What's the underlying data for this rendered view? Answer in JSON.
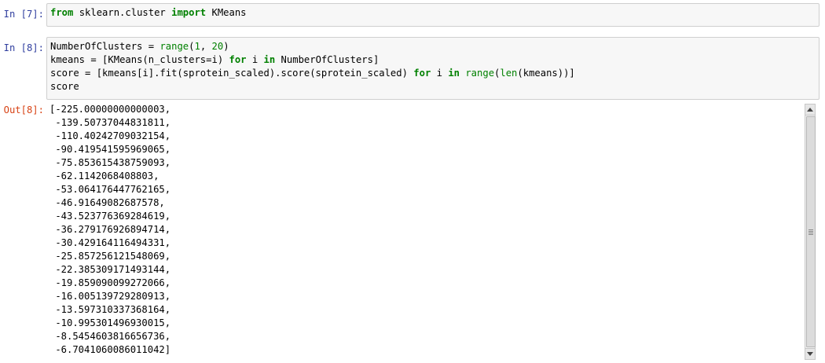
{
  "cells": [
    {
      "prompt": "In [7]:",
      "lines": [
        [
          {
            "t": "from",
            "c": "kw"
          },
          {
            "t": " sklearn.cluster ",
            "c": ""
          },
          {
            "t": "import",
            "c": "kw"
          },
          {
            "t": " KMeans",
            "c": ""
          }
        ]
      ]
    },
    {
      "prompt": "In [8]:",
      "lines": [
        [
          {
            "t": "NumberOfClusters ",
            "c": ""
          },
          {
            "t": "=",
            "c": "op"
          },
          {
            "t": " ",
            "c": ""
          },
          {
            "t": "range",
            "c": "bi"
          },
          {
            "t": "(",
            "c": ""
          },
          {
            "t": "1",
            "c": "num"
          },
          {
            "t": ", ",
            "c": ""
          },
          {
            "t": "20",
            "c": "num"
          },
          {
            "t": ")",
            "c": ""
          }
        ],
        [
          {
            "t": "kmeans ",
            "c": ""
          },
          {
            "t": "=",
            "c": "op"
          },
          {
            "t": " [KMeans(n_clusters",
            "c": ""
          },
          {
            "t": "=",
            "c": "op"
          },
          {
            "t": "i) ",
            "c": ""
          },
          {
            "t": "for",
            "c": "kw"
          },
          {
            "t": " i ",
            "c": ""
          },
          {
            "t": "in",
            "c": "kw"
          },
          {
            "t": " NumberOfClusters]",
            "c": ""
          }
        ],
        [
          {
            "t": "score ",
            "c": ""
          },
          {
            "t": "=",
            "c": "op"
          },
          {
            "t": " [kmeans[i].fit(sprotein_scaled).score(sprotein_scaled) ",
            "c": ""
          },
          {
            "t": "for",
            "c": "kw"
          },
          {
            "t": " i ",
            "c": ""
          },
          {
            "t": "in",
            "c": "kw"
          },
          {
            "t": " ",
            "c": ""
          },
          {
            "t": "range",
            "c": "bi"
          },
          {
            "t": "(",
            "c": ""
          },
          {
            "t": "len",
            "c": "bi"
          },
          {
            "t": "(kmeans))]",
            "c": ""
          }
        ],
        [
          {
            "t": "score",
            "c": ""
          }
        ]
      ]
    }
  ],
  "output": {
    "prompt": "Out[8]:",
    "lines": [
      "[-225.00000000000003,",
      " -139.50737044831811,",
      " -110.40242709032154,",
      " -90.419541595969065,",
      " -75.853615438759093,",
      " -62.1142068408803,",
      " -53.064176447762165,",
      " -46.91649082687578,",
      " -43.523776369284619,",
      " -36.279176926894714,",
      " -30.429164116494331,",
      " -25.857256121548069,",
      " -22.385309171493144,",
      " -19.859090099272066,",
      " -16.005139729280913,",
      " -13.597310337368164,",
      " -10.995301496930015,",
      " -8.5454603816656736,",
      " -6.7041060086011042]"
    ]
  },
  "icons": {
    "scroll_up": "arrow-up-icon",
    "scroll_down": "arrow-down-icon",
    "thumb_grip": "grip-icon"
  }
}
